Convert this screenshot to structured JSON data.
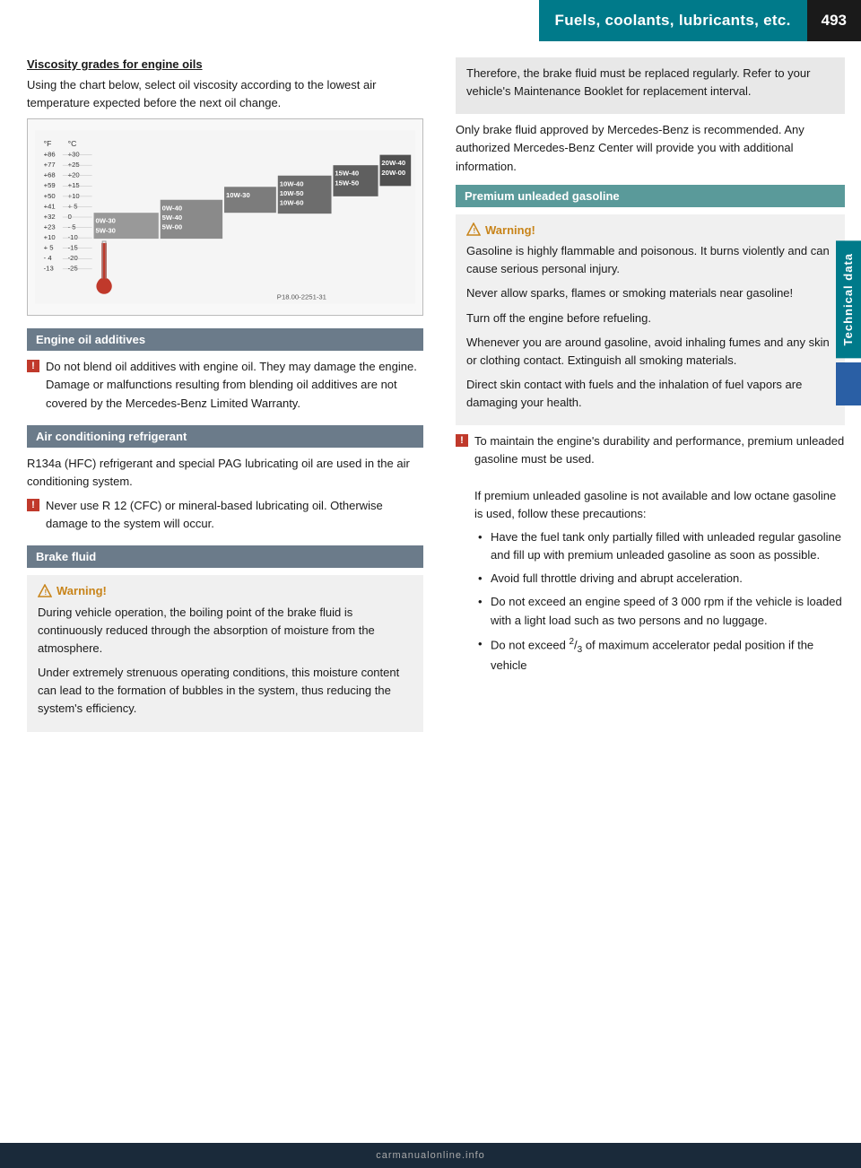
{
  "header": {
    "title": "Fuels, coolants, lubricants, etc.",
    "page_number": "493"
  },
  "side_tab": {
    "label": "Technical data"
  },
  "left_column": {
    "viscosity_section": {
      "title": "Viscosity grades for engine oils",
      "intro": "Using the chart below, select oil viscosity according to the lowest air temperature expected before the next oil change.",
      "chart_note": "P18.00-2251-31"
    },
    "engine_oil_additives": {
      "header": "Engine oil additives",
      "notice": "Do not blend oil additives with engine oil. They may damage the engine. Damage or malfunctions resulting from blending oil additives are not covered by the Mercedes-Benz Limited Warranty."
    },
    "air_conditioning": {
      "header": "Air conditioning refrigerant",
      "text": "R134a (HFC) refrigerant and special PAG lubricating oil are used in the air conditioning system.",
      "notice": "Never use R 12 (CFC) or mineral-based lubricating oil. Otherwise damage to the system will occur."
    },
    "brake_fluid": {
      "header": "Brake fluid",
      "warning_label": "Warning!",
      "warning_text1": "During vehicle operation, the boiling point of the brake fluid is continuously reduced through the absorption of moisture from the atmosphere.",
      "warning_text2": "Under extremely strenuous operating conditions, this moisture content can lead to the formation of bubbles in the system, thus reducing the system's efficiency."
    }
  },
  "right_column": {
    "brake_info_box": {
      "text1": "Therefore, the brake fluid must be replaced regularly. Refer to your vehicle's Maintenance Booklet for replacement interval."
    },
    "brake_para": "Only brake fluid approved by Mercedes-Benz is recommended. Any authorized Mercedes-Benz Center will provide you with additional information.",
    "premium_gasoline": {
      "header": "Premium unleaded gasoline",
      "warning_label": "Warning!",
      "warning_para1": "Gasoline is highly flammable and poisonous. It burns violently and can cause serious personal injury.",
      "warning_para2": "Never allow sparks, flames or smoking materials near gasoline!",
      "warning_para3": "Turn off the engine before refueling.",
      "warning_para4": "Whenever you are around gasoline, avoid inhaling fumes and any skin or clothing contact. Extinguish all smoking materials.",
      "warning_para5": "Direct skin contact with fuels and the inhalation of fuel vapors are damaging your health."
    },
    "engine_notice": "To maintain the engine's durability and performance, premium unleaded gasoline must be used.",
    "if_not_available": "If premium unleaded gasoline is not available and low octane gasoline is used, follow these precautions:",
    "precautions": [
      "Have the fuel tank only partially filled with unleaded regular gasoline and fill up with premium unleaded gasoline as soon as possible.",
      "Avoid full throttle driving and abrupt acceleration.",
      "Do not exceed an engine speed of 3 000 rpm if the vehicle is loaded with a light load such as two persons and no luggage.",
      "Do not exceed ²/₃ of maximum accelerator pedal position if the vehicle"
    ]
  },
  "footer": {
    "symbol": "▷▷"
  },
  "watermark": {
    "text": "carmanualonline.info"
  }
}
